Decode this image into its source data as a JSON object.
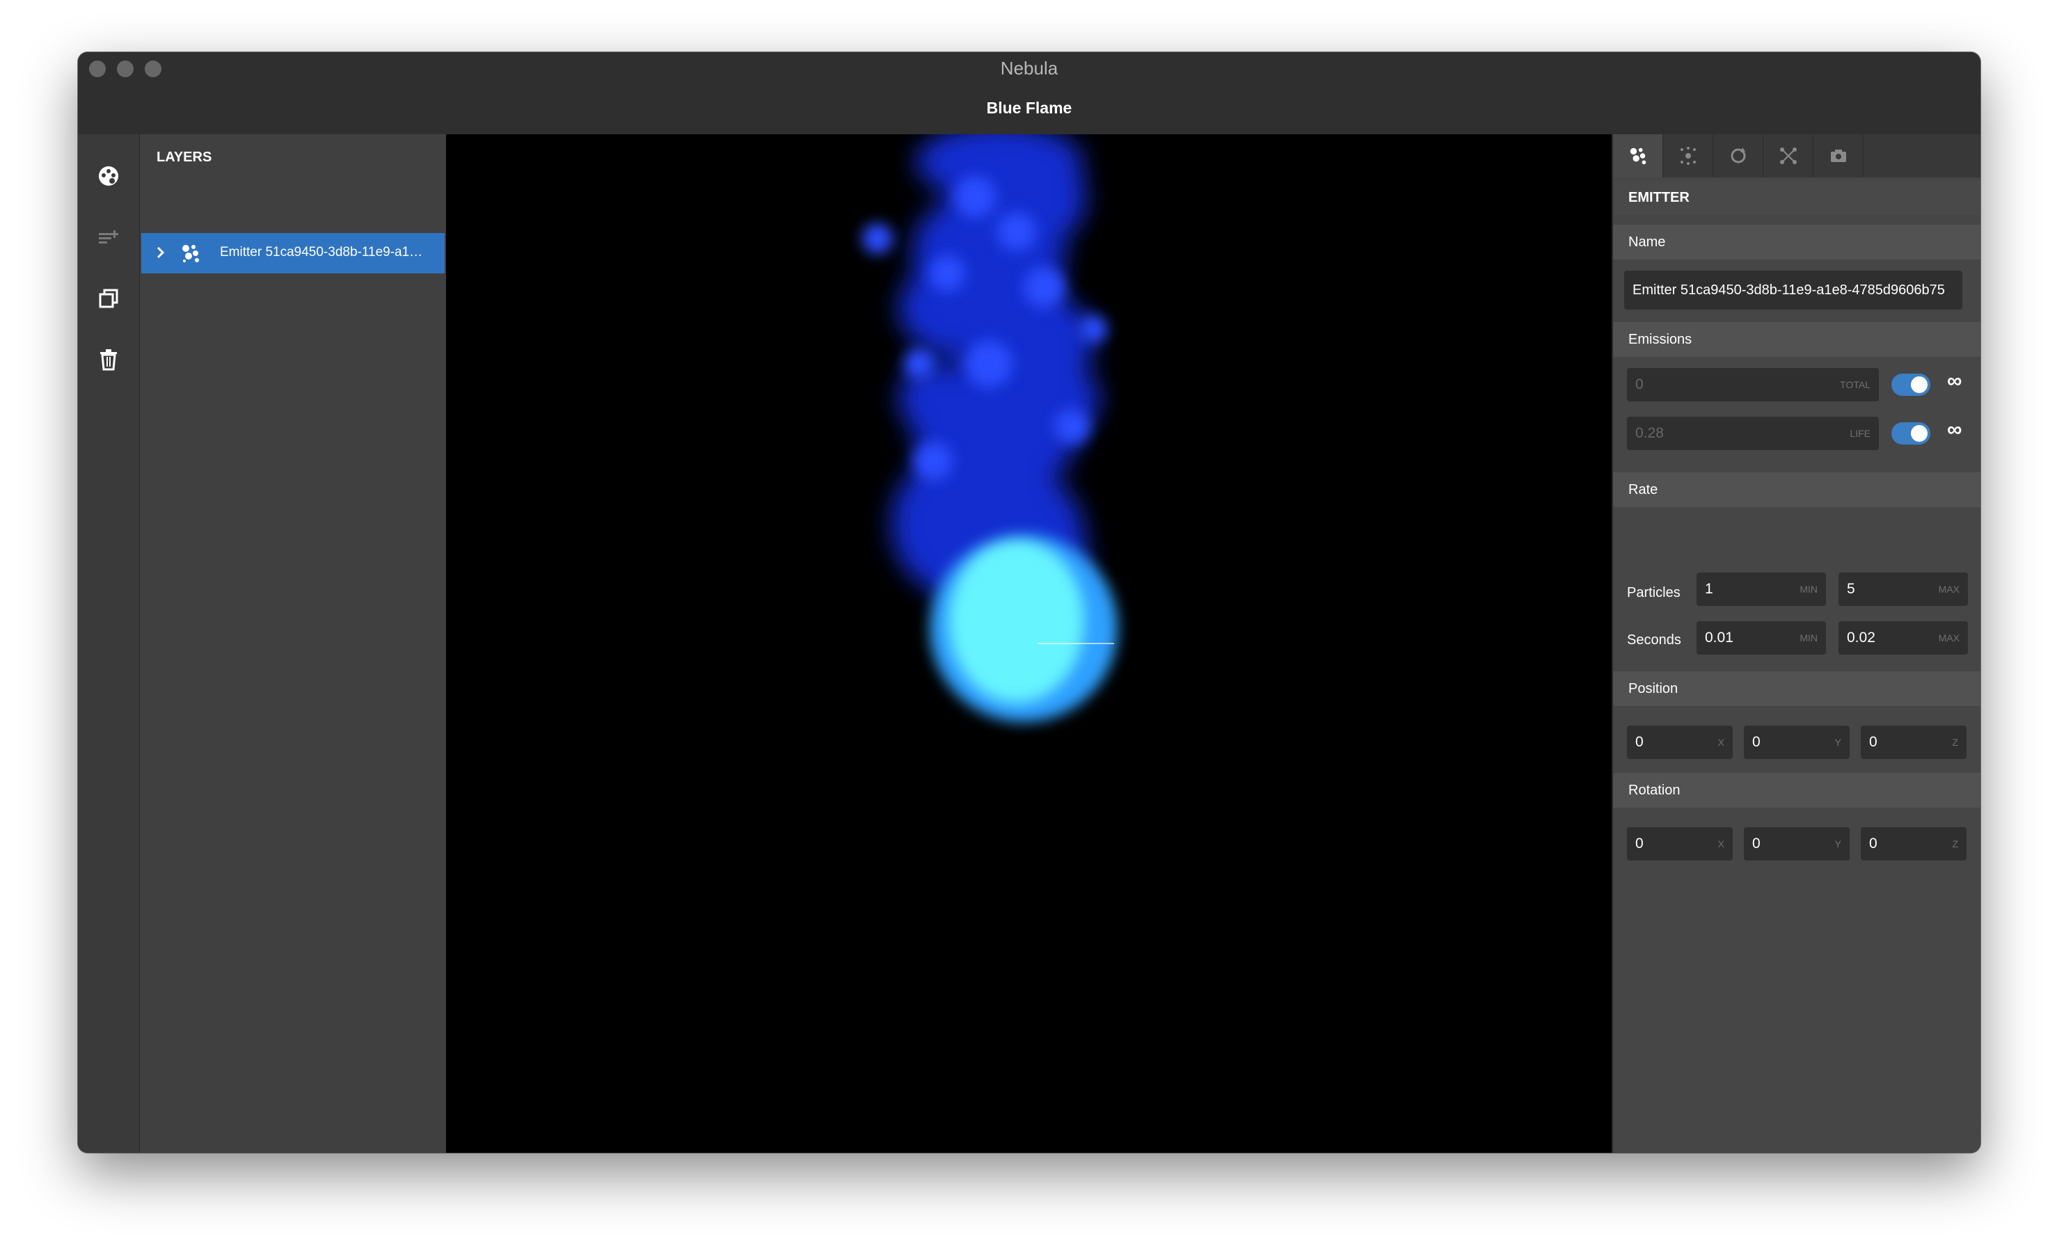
{
  "window": {
    "app_title": "Nebula",
    "document_title": "Blue Flame"
  },
  "toolbar": {
    "icons": [
      "palette-icon",
      "add-layer-icon",
      "duplicate-icon",
      "trash-icon"
    ]
  },
  "layers": {
    "heading": "LAYERS",
    "items": [
      {
        "name": "Emitter 51ca9450-3d8b-11e9-a1…",
        "expanded": false,
        "selected": true
      }
    ]
  },
  "inspector": {
    "tabs": [
      "emitter-tab",
      "particles-tab",
      "rotation-tab",
      "nodes-tab",
      "camera-tab"
    ],
    "section_title": "EMITTER",
    "name": {
      "label": "Name",
      "value": "Emitter 51ca9450-3d8b-11e9-a1e8-4785d9606b75"
    },
    "emissions": {
      "label": "Emissions",
      "total": {
        "value": "0",
        "suffix": "TOTAL",
        "infinite": true,
        "infinite_symbol": "∞"
      },
      "life": {
        "value": "0.28",
        "suffix": "LIFE",
        "infinite": true,
        "infinite_symbol": "∞"
      }
    },
    "rate": {
      "label": "Rate",
      "particles": {
        "label": "Particles",
        "min": "1",
        "max": "5",
        "min_suffix": "MIN",
        "max_suffix": "MAX"
      },
      "seconds": {
        "label": "Seconds",
        "min": "0.01",
        "max": "0.02",
        "min_suffix": "MIN",
        "max_suffix": "MAX"
      }
    },
    "position": {
      "label": "Position",
      "x": "0",
      "y": "0",
      "z": "0",
      "sx": "X",
      "sy": "Y",
      "sz": "Z"
    },
    "rotation": {
      "label": "Rotation",
      "x": "0",
      "y": "0",
      "z": "0",
      "sx": "X",
      "sy": "Y",
      "sz": "Z"
    }
  },
  "colors": {
    "accent": "#2f74c0",
    "flame_core": "#66f4ff",
    "flame_outer": "#1a3cff"
  }
}
